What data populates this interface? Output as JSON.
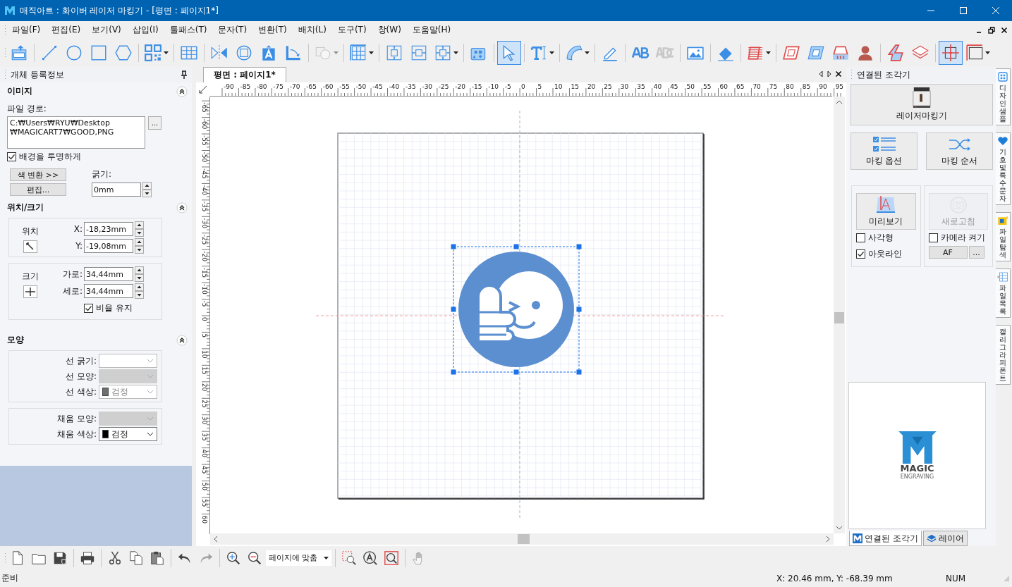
{
  "window": {
    "title": "매직아트 : 화이버 레이저 마킹기 - [평면 : 페이지1*]"
  },
  "menu": [
    "파일(F)",
    "편집(E)",
    "보기(V)",
    "삽입(I)",
    "툴패스(T)",
    "문자(T)",
    "변환(T)",
    "배치(L)",
    "도구(T)",
    "창(W)",
    "도움말(H)"
  ],
  "toolbar": [
    [
      {
        "kind": "svg",
        "selected": false,
        "dropdown": false,
        "disabled": false
      }
    ],
    [
      {
        "kind": "line",
        "selected": false,
        "dropdown": false,
        "disabled": false
      },
      {
        "kind": "circle",
        "selected": false,
        "dropdown": false,
        "disabled": false
      },
      {
        "kind": "square",
        "selected": false,
        "dropdown": false,
        "disabled": false
      },
      {
        "kind": "hexagon",
        "selected": false,
        "dropdown": false,
        "disabled": false
      }
    ],
    [
      {
        "kind": "qr",
        "selected": false,
        "dropdown": true,
        "disabled": false
      }
    ],
    [
      {
        "kind": "table",
        "selected": false,
        "dropdown": false,
        "disabled": false
      }
    ],
    [
      {
        "kind": "mirror",
        "selected": false,
        "dropdown": false,
        "disabled": false
      },
      {
        "kind": "rotate",
        "selected": false,
        "dropdown": false,
        "disabled": false
      },
      {
        "kind": "letter",
        "selected": false,
        "dropdown": false,
        "disabled": false
      },
      {
        "kind": "corner",
        "selected": false,
        "dropdown": false,
        "disabled": false
      }
    ],
    [
      {
        "kind": "shapes",
        "selected": false,
        "dropdown": true,
        "disabled": true
      }
    ],
    [
      {
        "kind": "array",
        "selected": false,
        "dropdown": true,
        "disabled": false
      }
    ],
    [
      {
        "kind": "align-v",
        "selected": false,
        "dropdown": false,
        "disabled": false
      },
      {
        "kind": "align-h",
        "selected": false,
        "dropdown": false,
        "disabled": false
      },
      {
        "kind": "align-c",
        "selected": false,
        "dropdown": true,
        "disabled": false
      }
    ],
    [
      {
        "kind": "cards",
        "selected": false,
        "dropdown": false,
        "disabled": false
      }
    ],
    [
      {
        "kind": "pointer",
        "selected": true,
        "dropdown": false,
        "disabled": false
      }
    ],
    [
      {
        "kind": "text",
        "selected": false,
        "dropdown": true,
        "disabled": false
      }
    ],
    [
      {
        "kind": "arc",
        "selected": false,
        "dropdown": true,
        "disabled": false
      }
    ],
    [
      {
        "kind": "pencil",
        "selected": false,
        "dropdown": false,
        "disabled": false
      }
    ],
    [
      {
        "kind": "outline",
        "selected": false,
        "dropdown": false,
        "disabled": false
      },
      {
        "kind": "letters",
        "selected": false,
        "dropdown": false,
        "disabled": true
      }
    ],
    [
      {
        "kind": "image",
        "selected": false,
        "dropdown": false,
        "disabled": false
      }
    ],
    [
      {
        "kind": "eraser",
        "selected": false,
        "dropdown": false,
        "disabled": false
      }
    ],
    [
      {
        "kind": "hatch",
        "selected": false,
        "dropdown": true,
        "disabled": false
      }
    ],
    [
      {
        "kind": "para",
        "selected": false,
        "dropdown": false,
        "disabled": false
      },
      {
        "kind": "slant",
        "selected": false,
        "dropdown": false,
        "disabled": false
      },
      {
        "kind": "stamp",
        "selected": false,
        "dropdown": false,
        "disabled": false
      },
      {
        "kind": "bust",
        "selected": false,
        "dropdown": false,
        "disabled": false
      }
    ],
    [
      {
        "kind": "bent",
        "selected": false,
        "dropdown": false,
        "disabled": false
      },
      {
        "kind": "layers",
        "selected": false,
        "dropdown": false,
        "disabled": false
      }
    ],
    [
      {
        "kind": "crosshair",
        "selected": true,
        "dropdown": false,
        "disabled": false
      },
      {
        "kind": "frame",
        "selected": false,
        "dropdown": true,
        "disabled": false
      }
    ]
  ],
  "object_panel": {
    "title": "개체 등록정보",
    "image": {
      "heading": "이미지",
      "path_label": "파일 경로:",
      "path": "C:₩Users₩RYU₩Desktop\n₩MAGICART7₩GOOD,PNG",
      "browse_button": "...",
      "transparent": {
        "label": "배경을 투명하게",
        "checked": true
      },
      "color_button": "색 변환 >>",
      "edit_button": "편집...",
      "thickness": {
        "label": "굵기:",
        "value": "0mm"
      }
    },
    "geometry": {
      "heading": "위치/크기",
      "position_label": "위치",
      "size_label": "크기",
      "position_fields": [
        {
          "label": "X:",
          "value": "-18,23mm"
        },
        {
          "label": "Y:",
          "value": "-19,08mm"
        }
      ],
      "size_fields": [
        {
          "label": "가로:",
          "value": "34,44mm"
        },
        {
          "label": "세로:",
          "value": "34,44mm"
        }
      ],
      "keep_ratio": {
        "label": "비율 유지",
        "checked": true
      }
    },
    "shape": {
      "heading": "모양",
      "line_fields": [
        {
          "label": "선 굵기:",
          "disabled": false,
          "dimmed": true
        },
        {
          "label": "선 모양:",
          "disabled": true,
          "dimmed": true
        },
        {
          "label": "선 색상:",
          "disabled": false,
          "dimmed": true,
          "value": "검정",
          "color": "#6e6e6e"
        }
      ],
      "fill_fields": [
        {
          "label": "채움 모양:",
          "disabled": true,
          "dimmed": true
        },
        {
          "label": "채움 색상:",
          "disabled": false,
          "dimmed": false,
          "value": "검정",
          "color": "#000000"
        }
      ]
    }
  },
  "document_tabs": [
    {
      "label": "평면 : 페이지1*",
      "selected": true
    }
  ],
  "ruler": {
    "horizontal": [
      "-90",
      "-85",
      "-80",
      "-75",
      "-70",
      "-65",
      "-60",
      "-55",
      "-50",
      "-45",
      "-40",
      "-35",
      "-30",
      "-25",
      "-20",
      "-15",
      "-10",
      "-5",
      "0",
      "5",
      "10",
      "15",
      "20",
      "25",
      "30",
      "35",
      "40",
      "45",
      "50",
      "55",
      "60",
      "65",
      "70",
      "75",
      "80",
      "85",
      "90",
      "95"
    ],
    "vertical": [
      "-65",
      "-60",
      "-55",
      "-50",
      "-45",
      "-40",
      "-35",
      "-30",
      "-25",
      "-20",
      "-15",
      "-10",
      "-5",
      "0",
      "5",
      "10",
      "15",
      "20",
      "25",
      "30",
      "35",
      "40",
      "45",
      "50",
      "55",
      "60"
    ]
  },
  "engraver_panel": {
    "title": "연결된 조각기",
    "machine_button": "레이저마킹기",
    "option_buttons": [
      {
        "label": "마킹 옵션",
        "kind": "checklist"
      },
      {
        "label": "마킹 순서",
        "kind": "shuffle"
      }
    ],
    "preview": {
      "button": "미리보기",
      "disabled": false,
      "options": [
        {
          "label": "사각형",
          "checked": false
        },
        {
          "label": "아웃라인",
          "checked": true
        }
      ]
    },
    "camera": {
      "button": "새로고침",
      "disabled": true,
      "option": {
        "label": "카메라 켜기",
        "checked": false
      },
      "af_button": "AF",
      "more_button": "..."
    },
    "logo": {
      "name": "MAGIC",
      "sub": "ENGRAVING"
    }
  },
  "panel_tabs": [
    {
      "label": "연결된 조각기",
      "selected": true
    },
    {
      "label": "레이어",
      "selected": false
    }
  ],
  "side_tabs": [
    {
      "label": "디자인 샘플",
      "kind": "samples"
    },
    {
      "label": "기호 및 특수문자",
      "kind": "heart"
    },
    {
      "label": "파일 탐색",
      "kind": "folder"
    },
    {
      "label": "파일 목록",
      "kind": "list"
    },
    {
      "label": "캘리그라피 폰트",
      "kind": "none"
    }
  ],
  "bottom_toolbar": [
    [
      {
        "kind": "new",
        "disabled": false
      },
      {
        "kind": "open",
        "disabled": false
      },
      {
        "kind": "save",
        "disabled": false
      }
    ],
    [
      {
        "kind": "print",
        "disabled": false
      }
    ],
    [
      {
        "kind": "cut",
        "disabled": false
      },
      {
        "kind": "copy",
        "disabled": false
      },
      {
        "kind": "paste",
        "disabled": false
      }
    ],
    [
      {
        "kind": "undo",
        "disabled": false
      },
      {
        "kind": "redo",
        "disabled": true
      }
    ],
    [
      {
        "kind": "zoom-in",
        "disabled": false
      },
      {
        "kind": "zoom-out",
        "disabled": false
      },
      {
        "kind": "zoom-select",
        "label": "페이지에 맞춤",
        "disabled": false
      }
    ],
    [
      {
        "kind": "zoom-area",
        "disabled": false
      },
      {
        "kind": "zoom-letter",
        "disabled": false
      },
      {
        "kind": "zoom-box",
        "disabled": false
      }
    ],
    [
      {
        "kind": "hand",
        "disabled": true
      }
    ]
  ],
  "status_bar": {
    "message": "준비",
    "cursor": "X: 20.46 mm,  Y: -68.39 mm",
    "num": "NUM"
  }
}
